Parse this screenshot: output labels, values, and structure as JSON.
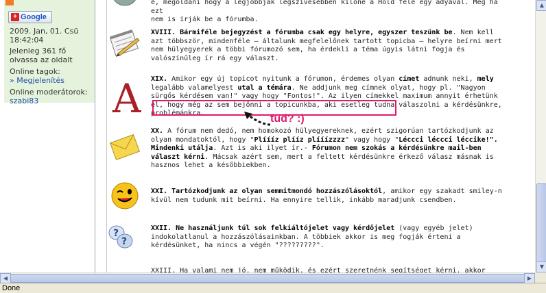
{
  "sidebar": {
    "google_button": {
      "plus": "+",
      "label": "Google"
    },
    "datetime_line1": "2009. Jan, 01. Csü",
    "datetime_line2": "18:42:04",
    "online_line1": "Jelenleg 361 fő",
    "online_line2": "olvassa az oldalt",
    "members_label": "Online tagok:",
    "members_link": "» Megjelenítés",
    "moderators_label": "Online moderátorok:",
    "moderator_name": "szabi83"
  },
  "content": {
    "top_line1": "e, megoldani hogy a legjobbjak legszívesebben kilőné a Hold felé egy adyával. Meg ha ezt",
    "top_line2": "nem is írják be a fórumba.",
    "items": [
      {
        "icon": "notepad-pencil-icon",
        "heading": "XVIII. Bármiféle bejegyzést a fórumba csak egy helyre, egyszer teszünk be",
        "heading_end": ".",
        "body": " Nem kell azt többször, mindenféle – általunk megfelelőnek tartott topicba – helyre beírni mert nem hülyegyerek a többi fórumozó sem, ha érdekli a téma úgyis látni fogja és valószínűleg ír rá egy választ."
      },
      {
        "icon": "letter-a-icon",
        "heading": "XIX.",
        "body_1": " Amikor egy új topicot nyitunk a fórumon, érdemes olyan ",
        "bold_1": "címet",
        "body_2": " adnunk neki, ",
        "bold_2": "mely",
        "body_3": " legalább valamelyest ",
        "bold_3": "utal a témára",
        "body_4": ". Ne addjunk meg címnek olyat, hogy pl. \"Nagyon sürgős kérdésem van!\" vagy hogy \"Fontos!\". Az ilyen címekkel maximum annyit érhetünk el, hogy még az sem bejönni a topicunkba, aki esetleg tudna válaszolni a kérdésünkre, problémánkra."
      },
      {
        "icon": "envelope-icon",
        "heading": "XX.",
        "body_1": " A fórum nem dedó, nem homokozó hülyegyereknek, ezért szigorúan tartózkodjunk az olyan mondatoktól, hogy \"",
        "bold_1": "Plíííz plííz plííízzzz",
        "body_2": "\" vagy hogy \"",
        "bold_2": "Léccci léccci léccike!\". Mindenki utálja",
        "body_3": ". Azt is aki ilyet ír.- ",
        "bold_3": "Fórumon nem szokás a kérdésünkre mail-ben választ kérni",
        "body_4": ". Mácsak azért sem, mert a feltett kérdésünkre érkező válasz másnak is hasznos lehet a későbbiekben."
      },
      {
        "icon": "winking-smiley-icon",
        "heading": "XXI. Tartózkodjunk az olyan semmitmondó hozzászólásoktól",
        "body": ", amikor egy szakadt smiley-n kívül nem tudunk mit beírni. Ha ennyire tellik, inkább maradjunk csendben."
      },
      {
        "icon": "question-bubbles-icon",
        "heading": "XXII. Ne használjunk túl sok felkiáltójelet vagy kérdőjelet",
        "body": " (vagy egyéb jelet) indokolatlanul a hozzászólásainkban. A többiek akkor is meg fogják érteni a kérdésünket, ha nincs a végén \"?????????\"."
      }
    ],
    "cut_line": "XXIII. Ha valami nem jó, nem működik, és ezért szeretnénk segítséget kérni, akkor"
  },
  "annotation": {
    "text": "tud? :)",
    "color": "#e0196a"
  },
  "status": {
    "text": "Done"
  },
  "colors": {
    "sidebar_bg": "#e6f3dc",
    "link": "#1f4fa8",
    "scroll_thumb": "#b9c8ea"
  }
}
